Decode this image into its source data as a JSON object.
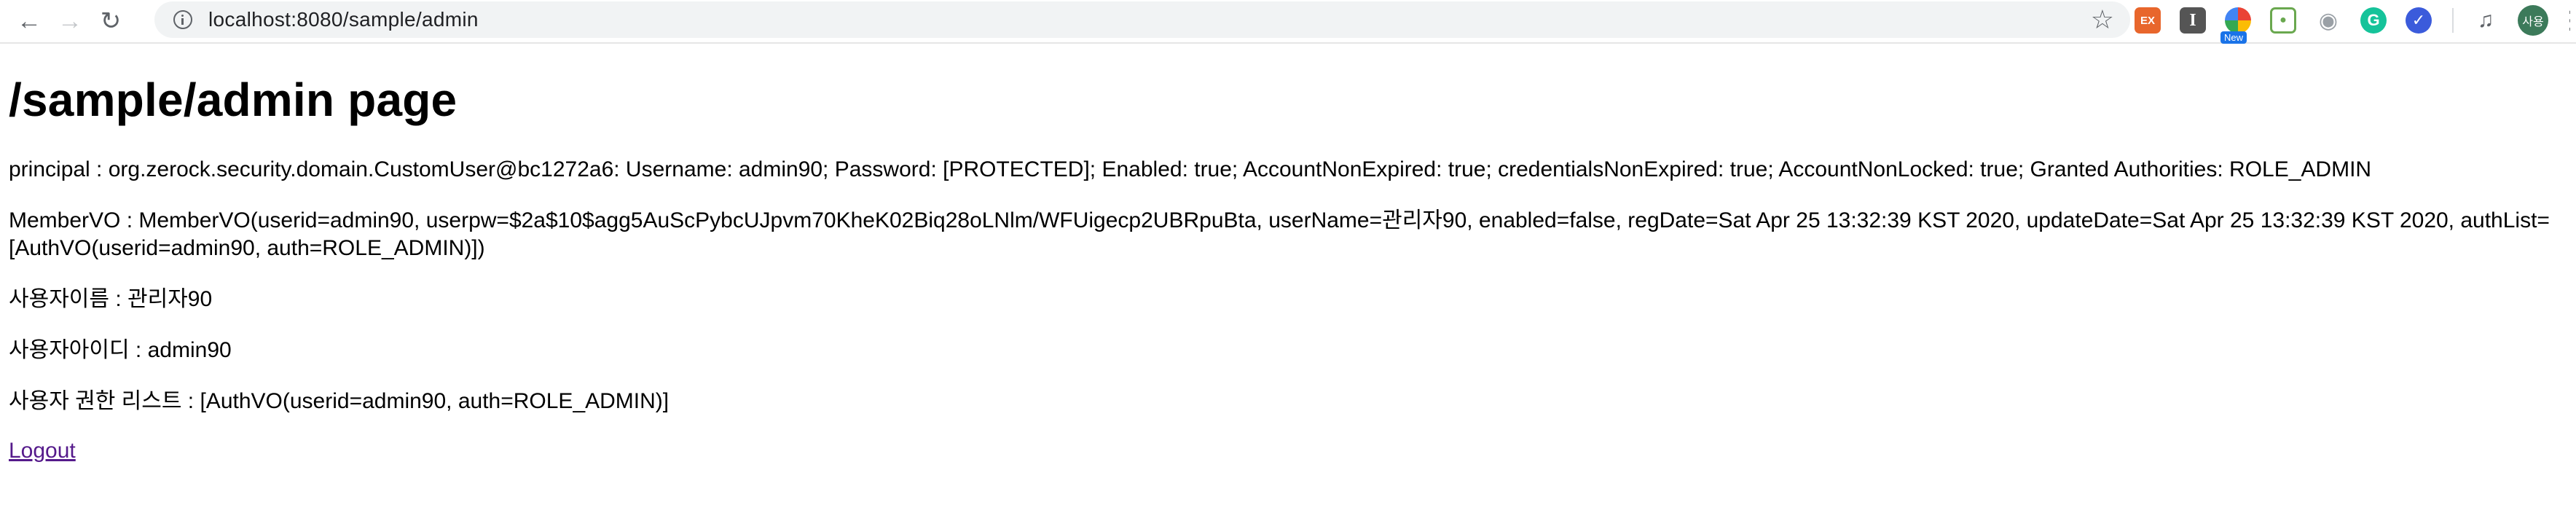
{
  "browser": {
    "url": "localhost:8080/sample/admin",
    "extensions": [
      {
        "name": "ex-extension",
        "label": "EX",
        "color": "#e8662c"
      },
      {
        "name": "i-extension",
        "label": "I",
        "color": "#555555"
      },
      {
        "name": "rainbow-extension",
        "badge": "New"
      },
      {
        "name": "bag-extension"
      },
      {
        "name": "camera-extension"
      },
      {
        "name": "grammarly-extension",
        "label": "G"
      },
      {
        "name": "check-extension"
      }
    ],
    "avatar_label": "사용"
  },
  "page": {
    "heading": "/sample/admin page",
    "principal": "principal : org.zerock.security.domain.CustomUser@bc1272a6: Username: admin90; Password: [PROTECTED]; Enabled: true; AccountNonExpired: true; credentialsNonExpired: true; AccountNonLocked: true; Granted Authorities: ROLE_ADMIN",
    "member_vo": "MemberVO : MemberVO(userid=admin90, userpw=$2a$10$agg5AuScPybcUJpvm70KheK02Biq28oLNlm/WFUigecp2UBRpuBta, userName=관리자90, enabled=false, regDate=Sat Apr 25 13:32:39 KST 2020, updateDate=Sat Apr 25 13:32:39 KST 2020, authList=[AuthVO(userid=admin90, auth=ROLE_ADMIN)])",
    "user_name": "사용자이름 : 관리자90",
    "user_id": "사용자아이디 : admin90",
    "auth_list": "사용자 권한 리스트 : [AuthVO(userid=admin90, auth=ROLE_ADMIN)]",
    "logout_label": "Logout"
  }
}
